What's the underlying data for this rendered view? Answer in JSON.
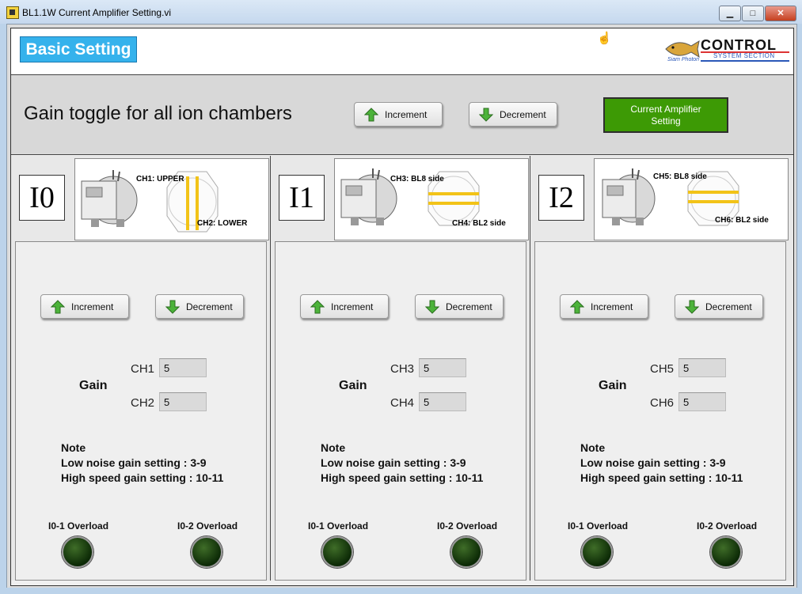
{
  "window": {
    "title": "BL1.1W Current Amplifier Setting.vi"
  },
  "header": {
    "basic_setting": "Basic Setting",
    "logo_text": "CONTROL",
    "logo_subtext": "SYSTEM SECTION",
    "logo_script": "Siam Photon"
  },
  "gain_toggle": {
    "title": "Gain toggle for all ion chambers",
    "increment_label": "Increment",
    "decrement_label": "Decrement",
    "current_amp_label": "Current Amplifier Setting"
  },
  "panels": [
    {
      "id": "I0",
      "ch_a_note": "CH1: UPPER",
      "ch_b_note": "CH2: LOWER",
      "increment_label": "Increment",
      "decrement_label": "Decrement",
      "gain_label": "Gain",
      "ch_a": {
        "label": "CH1",
        "value": "5"
      },
      "ch_b": {
        "label": "CH2",
        "value": "5"
      },
      "note_title": "Note",
      "note_line1": "Low noise gain setting : 3-9",
      "note_line2": "High speed gain setting : 10-11",
      "overload1": "I0-1 Overload",
      "overload2": "I0-2 Overload"
    },
    {
      "id": "I1",
      "ch_a_note": "CH3: BL8 side",
      "ch_b_note": "CH4: BL2 side",
      "increment_label": "Increment",
      "decrement_label": "Decrement",
      "gain_label": "Gain",
      "ch_a": {
        "label": "CH3",
        "value": "5"
      },
      "ch_b": {
        "label": "CH4",
        "value": "5"
      },
      "note_title": "Note",
      "note_line1": "Low noise gain setting : 3-9",
      "note_line2": "High speed gain setting : 10-11",
      "overload1": "I0-1 Overload",
      "overload2": "I0-2 Overload"
    },
    {
      "id": "I2",
      "ch_a_note": "CH5: BL8 side",
      "ch_b_note": "CH6: BL2 side",
      "increment_label": "Increment",
      "decrement_label": "Decrement",
      "gain_label": "Gain",
      "ch_a": {
        "label": "CH5",
        "value": "5"
      },
      "ch_b": {
        "label": "CH6",
        "value": "5"
      },
      "note_title": "Note",
      "note_line1": "Low noise gain setting : 3-9",
      "note_line2": "High speed gain setting : 10-11",
      "overload1": "I0-1 Overload",
      "overload2": "I0-2 Overload"
    }
  ],
  "colors": {
    "accent_blue": "#35b2ec",
    "green_button": "#3d9a05",
    "beam_yellow": "#f2c318",
    "led_off": "#1a3d0f"
  },
  "icons": {
    "increment": "green-up-arrow-icon",
    "decrement": "green-down-arrow-icon",
    "window_min": "minimize-icon",
    "window_max": "maximize-icon",
    "window_close": "close-icon",
    "cursor": "hand-cursor-icon"
  }
}
